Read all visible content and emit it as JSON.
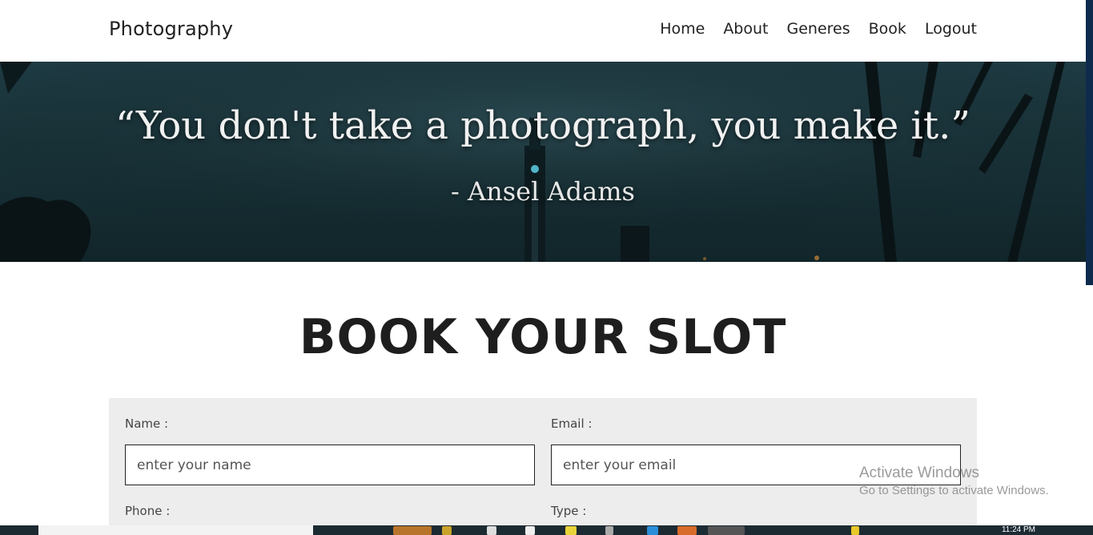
{
  "navbar": {
    "brand": "Photography",
    "links": [
      "Home",
      "About",
      "Generes",
      "Book",
      "Logout"
    ]
  },
  "hero": {
    "quote": "“You don't take a photograph, you make it.”",
    "author": "- Ansel Adams"
  },
  "section": {
    "title": "BOOK YOUR SLOT"
  },
  "form": {
    "name_label": "Name :",
    "name_placeholder": "enter your name",
    "email_label": "Email :",
    "email_placeholder": "enter your email",
    "phone_label": "Phone :",
    "type_label": "Type :"
  },
  "watermark": {
    "title": "Activate Windows",
    "subtitle": "Go to Settings to activate Windows."
  },
  "taskbar": {
    "time": "11:24 PM"
  },
  "colors": {
    "hero_bg": "#183238",
    "form_bg": "#ededed",
    "taskbar_bg": "#1c2a32",
    "right_strip": "#0e2a4d"
  }
}
